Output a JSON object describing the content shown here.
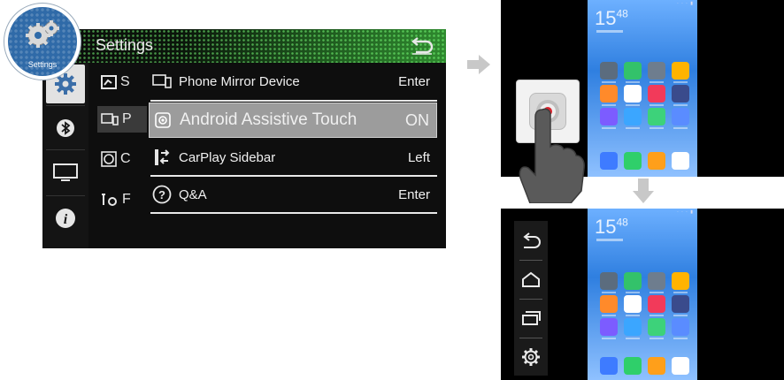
{
  "settings": {
    "title": "Settings",
    "logo_label": "Settings",
    "side_nav": [
      {
        "icon": "gear-icon",
        "active": true
      },
      {
        "icon": "bluetooth-icon",
        "active": false
      },
      {
        "icon": "monitor-icon",
        "active": false
      },
      {
        "icon": "info-icon",
        "active": false
      }
    ],
    "sub_menu": [
      {
        "icon": "screen-icon",
        "label": "S"
      },
      {
        "icon": "phone-mirror-icon",
        "label": "P"
      },
      {
        "icon": "camera-icon",
        "label": "C"
      },
      {
        "icon": "tools-icon",
        "label": "F"
      }
    ],
    "rows": [
      {
        "icon": "phone-mirror-icon",
        "label": "Phone Mirror Device",
        "value": "Enter",
        "selected": false
      },
      {
        "icon": "assistive-touch-icon",
        "label": "Android Assistive Touch",
        "value": "ON",
        "selected": true
      },
      {
        "icon": "sidebar-icon",
        "label": "CarPlay Sidebar",
        "value": "Left",
        "selected": false
      },
      {
        "icon": "help-icon",
        "label": "Q&A",
        "value": "Enter",
        "selected": false
      }
    ]
  },
  "phone": {
    "clock_hours": "15",
    "clock_minutes": "48",
    "app_colors": [
      "#5b6c7e",
      "#33c26a",
      "#6e7d8e",
      "#ffb300",
      "#ff8a2a",
      "#ffffff",
      "#f23a5a",
      "#3a4b8c",
      "#7c5cff",
      "#3ba6ff",
      "#3dd27a",
      "#5a8cff"
    ],
    "dock_colors": [
      "#3e7bff",
      "#2fcf6a",
      "#ff9f1a",
      "#ffffff"
    ]
  },
  "side_controls": [
    {
      "icon": "back-icon"
    },
    {
      "icon": "home-icon"
    },
    {
      "icon": "recents-icon"
    },
    {
      "icon": "settings-gear-icon"
    }
  ]
}
